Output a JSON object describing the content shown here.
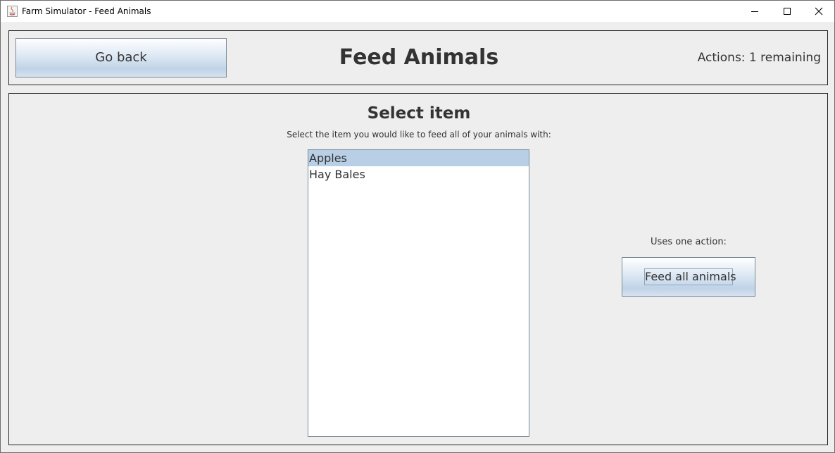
{
  "window": {
    "title": "Farm Simulator - Feed Animals",
    "app_icon": "java-icon",
    "controls": [
      "minimize-icon",
      "maximize-icon",
      "close-icon"
    ]
  },
  "header": {
    "back_label": "Go back",
    "title": "Feed Animals",
    "actions_text": "Actions: 1 remaining"
  },
  "main": {
    "section_title": "Select item",
    "subtitle": "Select the item you would like to feed all of your animals with:",
    "items": [
      {
        "label": "Apples",
        "selected": true
      },
      {
        "label": "Hay Bales",
        "selected": false
      }
    ],
    "action_hint": "Uses one action:",
    "feed_button_label": "Feed all animals"
  },
  "colors": {
    "background": "#eeeeee",
    "selection": "#b8cfe5",
    "text": "#333333"
  }
}
